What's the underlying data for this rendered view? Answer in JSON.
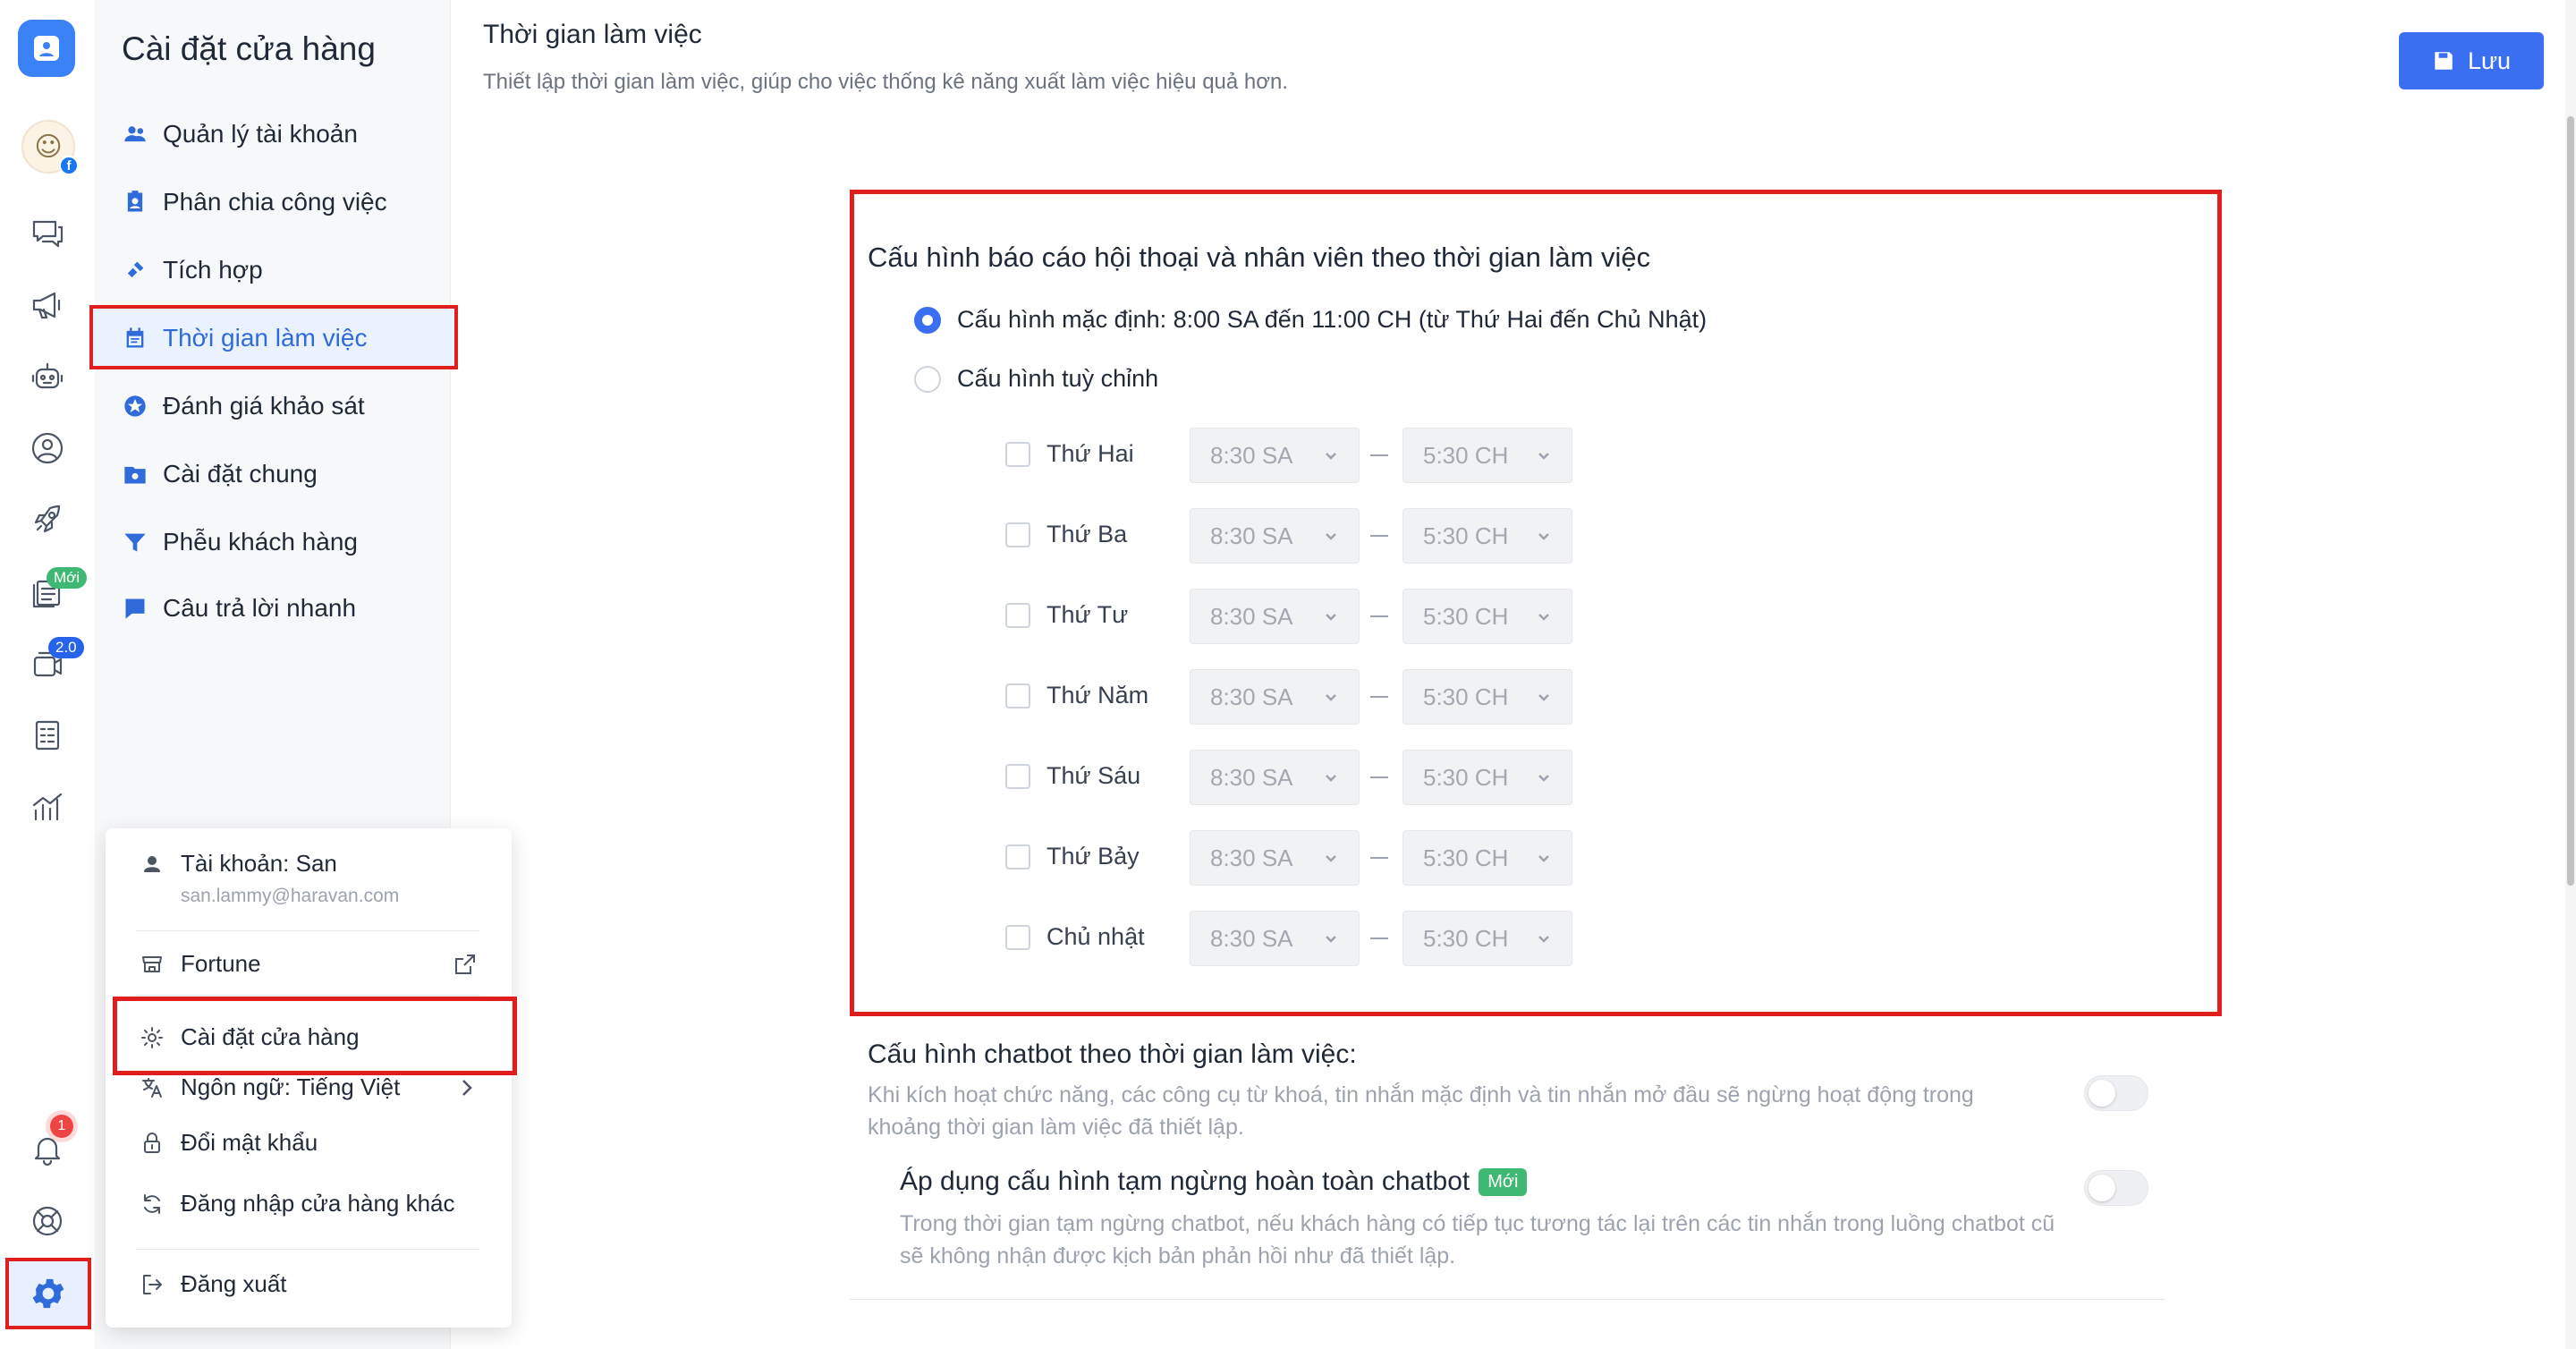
{
  "colors": {
    "primary": "#3b6ff2",
    "highlight": "#e01e1e",
    "new_badge": "#3fb874"
  },
  "rail": {
    "icons": [
      "app-logo",
      "avatar",
      "chat-icon",
      "megaphone-icon",
      "bot-icon",
      "user-circle-icon",
      "rocket-icon",
      "catalog-icon",
      "video-icon",
      "report-icon",
      "chart-icon",
      "bell-icon",
      "help-icon",
      "gear-icon"
    ],
    "avatar_face": "☺",
    "new_badge": "Mới",
    "version_badge": "2.0",
    "notification_count": "1"
  },
  "sidebar": {
    "title": "Cài đặt cửa hàng",
    "items": [
      {
        "label": "Quản lý tài khoản",
        "icon": "users-icon"
      },
      {
        "label": "Phân chia công việc",
        "icon": "badge-icon"
      },
      {
        "label": "Tích hợp",
        "icon": "plug-icon"
      },
      {
        "label": "Thời gian làm việc",
        "icon": "calendar-icon",
        "active": true
      },
      {
        "label": "Đánh giá khảo sát",
        "icon": "star-circle-icon"
      },
      {
        "label": "Cài đặt chung",
        "icon": "folder-gear-icon"
      },
      {
        "label": "Phễu khách hàng",
        "icon": "funnel-icon"
      },
      {
        "label": "Câu trả lời nhanh",
        "icon": "message-icon"
      }
    ]
  },
  "header": {
    "title": "Thời gian làm việc",
    "subtitle": "Thiết lập thời gian làm việc, giúp cho việc thống kê năng xuất làm việc hiệu quả hơn.",
    "save_label": "Lưu"
  },
  "config": {
    "title": "Cấu hình báo cáo hội thoại và nhân viên theo thời gian làm việc",
    "option_default": "Cấu hình mặc định: 8:00 SA đến 11:00 CH (từ Thứ Hai đến Chủ Nhật)",
    "option_custom": "Cấu hình tuỳ chỉnh",
    "selected_option": "default",
    "days": [
      {
        "label": "Thứ Hai",
        "start": "8:30 SA",
        "end": "5:30 CH",
        "checked": false
      },
      {
        "label": "Thứ Ba",
        "start": "8:30 SA",
        "end": "5:30 CH",
        "checked": false
      },
      {
        "label": "Thứ Tư",
        "start": "8:30 SA",
        "end": "5:30 CH",
        "checked": false
      },
      {
        "label": "Thứ Năm",
        "start": "8:30 SA",
        "end": "5:30 CH",
        "checked": false
      },
      {
        "label": "Thứ Sáu",
        "start": "8:30 SA",
        "end": "5:30 CH",
        "checked": false
      },
      {
        "label": "Thứ Bảy",
        "start": "8:30 SA",
        "end": "5:30 CH",
        "checked": false
      },
      {
        "label": "Chủ nhật",
        "start": "8:30 SA",
        "end": "5:30 CH",
        "checked": false
      }
    ]
  },
  "chatbot": {
    "title": "Cấu hình chatbot theo thời gian làm việc:",
    "description": "Khi kích hoạt chức năng, các công cụ từ khoá, tin nhắn mặc định và tin nhắn mở đầu sẽ ngừng hoạt động trong khoảng thời gian làm việc đã thiết lập.",
    "toggle_on": false,
    "pause_title": "Áp dụng cấu hình tạm ngừng hoàn toàn chatbot",
    "pause_badge": "Mới",
    "pause_description": "Trong thời gian tạm ngừng chatbot, nếu khách hàng có tiếp tục tương tác lại trên các tin nhắn trong luồng chatbot cũ sẽ không nhận được kịch bản phản hồi như đã thiết lập.",
    "pause_toggle_on": false
  },
  "menu": {
    "account_label": "Tài khoản: San",
    "account_email": "san.lammy@haravan.com",
    "store_name": "Fortune",
    "store_settings": "Cài đặt cửa hàng",
    "language": "Ngôn ngữ: Tiếng Việt",
    "change_password": "Đổi mật khẩu",
    "switch_store": "Đăng nhập cửa hàng khác",
    "logout": "Đăng xuất"
  }
}
